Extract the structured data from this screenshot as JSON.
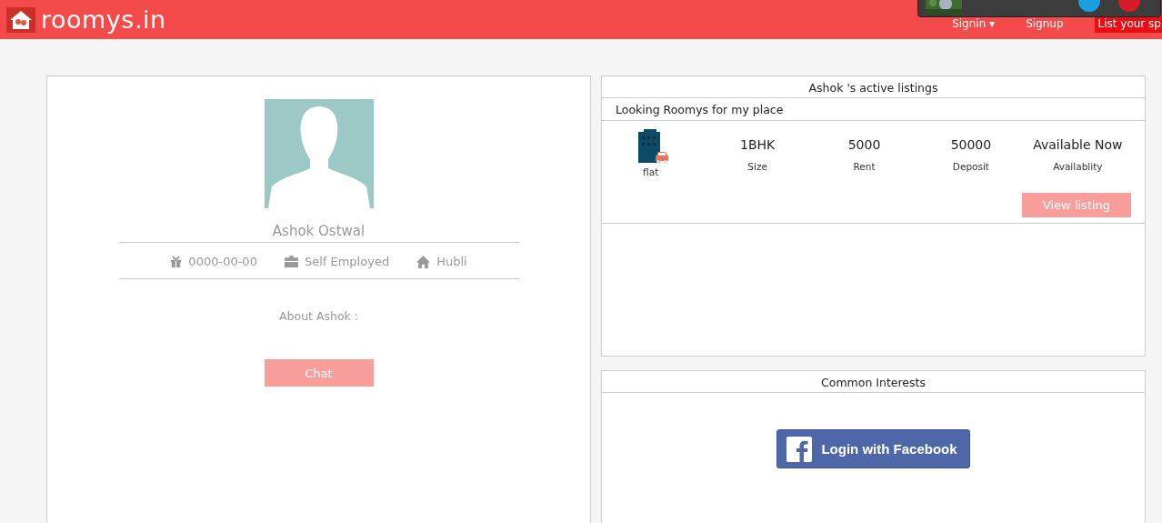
{
  "header": {
    "logo": "roomys.in",
    "nav": [
      {
        "label": "Signin ▾",
        "kind": "link"
      },
      {
        "label": "Signup",
        "kind": "link"
      },
      {
        "label": "List your sp",
        "kind": "cta"
      }
    ]
  },
  "profile": {
    "name": "Ashok Ostwal",
    "details": [
      {
        "kind": "birthday",
        "text": "0000-00-00"
      },
      {
        "kind": "work",
        "text": "Self Employed"
      },
      {
        "kind": "home",
        "text": "Hubli"
      }
    ],
    "about": "About Ashok :",
    "chat_button": "Chat"
  },
  "listings": {
    "title": "Ashok 's active listings",
    "section": "Looking Roomys for my place",
    "items": [
      {
        "type": "flat",
        "stats": [
          {
            "value": "1BHK",
            "label": "Size"
          },
          {
            "value": "5000",
            "label": "Rent"
          },
          {
            "value": "50000",
            "label": "Deposit"
          },
          {
            "value": "Available Now",
            "label": "Availablity"
          }
        ],
        "button": "View listing"
      }
    ]
  },
  "interests": {
    "title": "Common Interests",
    "facebook_button": "Login with Facebook"
  }
}
